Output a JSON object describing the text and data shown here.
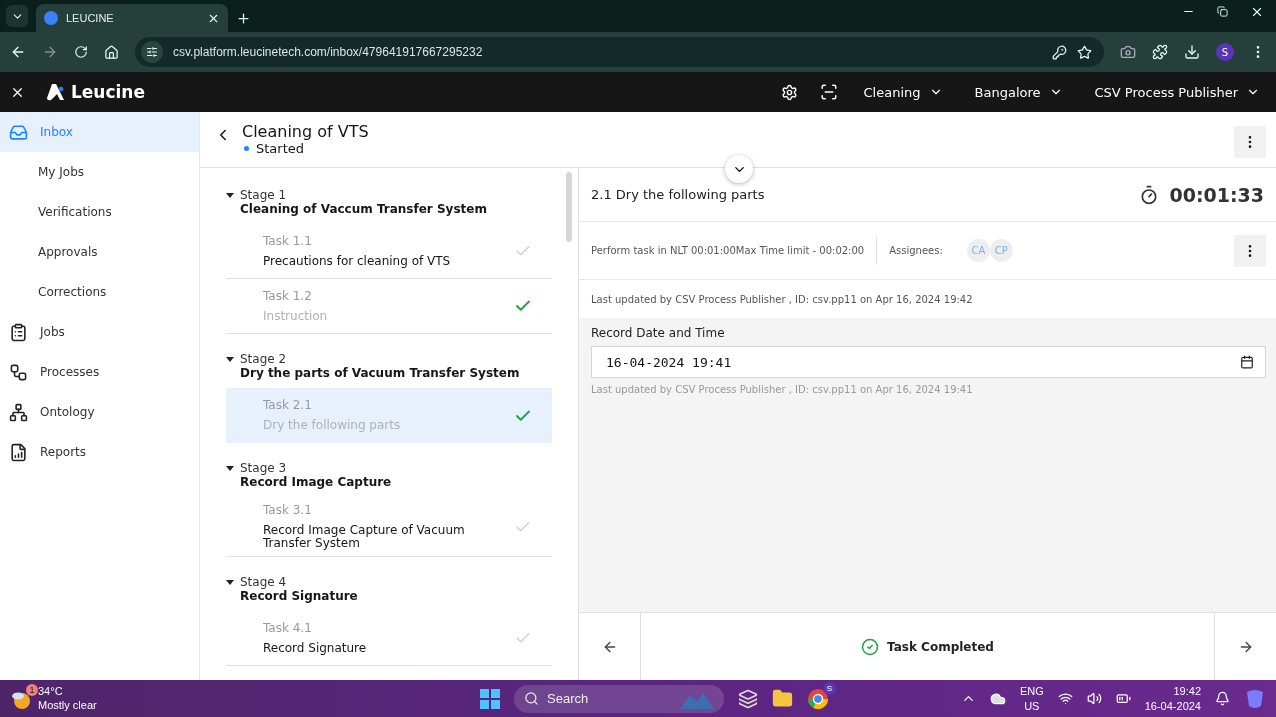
{
  "browser": {
    "tab_title": "LEUCINE",
    "url": "csv.platform.leucinetech.com/inbox/479641917667295232",
    "profile_initial": "S"
  },
  "app": {
    "brand": "Leucine",
    "dropdowns": [
      "Cleaning",
      "Bangalore",
      "CSV Process Publisher"
    ]
  },
  "sidebar": {
    "items": [
      {
        "label": "Inbox",
        "kind": "inbox",
        "selected": true
      },
      {
        "label": "My Jobs",
        "kind": "sub",
        "selected": false
      },
      {
        "label": "Verifications",
        "kind": "sub",
        "selected": false
      },
      {
        "label": "Approvals",
        "kind": "sub",
        "selected": false
      },
      {
        "label": "Corrections",
        "kind": "sub",
        "selected": false
      },
      {
        "label": "Jobs",
        "kind": "jobs",
        "selected": false
      },
      {
        "label": "Processes",
        "kind": "processes",
        "selected": false
      },
      {
        "label": "Ontology",
        "kind": "ontology",
        "selected": false
      },
      {
        "label": "Reports",
        "kind": "reports",
        "selected": false
      }
    ]
  },
  "job": {
    "title": "Cleaning of VTS",
    "status": "Started"
  },
  "stages": [
    {
      "label": "Stage 1",
      "name": "Cleaning of Vaccum Transfer System",
      "expanded": true,
      "tasks": [
        {
          "number": "Task 1.1",
          "name": "Precautions for cleaning of VTS",
          "completed": false,
          "selected": false
        },
        {
          "number": "Task 1.2",
          "name": "Instruction",
          "completed": true,
          "selected": false
        }
      ]
    },
    {
      "label": "Stage 2",
      "name": "Dry the parts of Vacuum Transfer System",
      "expanded": true,
      "tasks": [
        {
          "number": "Task 2.1",
          "name": "Dry the following parts",
          "completed": true,
          "selected": true
        }
      ]
    },
    {
      "label": "Stage 3",
      "name": "Record Image Capture",
      "expanded": true,
      "tasks": [
        {
          "number": "Task 3.1",
          "name": "Record Image Capture of Vacuum Transfer System",
          "completed": false,
          "selected": false
        }
      ]
    },
    {
      "label": "Stage 4",
      "name": "Record Signature",
      "expanded": true,
      "tasks": [
        {
          "number": "Task 4.1",
          "name": "Record Signature",
          "completed": false,
          "selected": false
        }
      ]
    }
  ],
  "task": {
    "title": "2.1 Dry the following parts",
    "timer": "00:01:33",
    "time_limit": "Perform task in NLT 00:01:00Max Time limit - 00:02:00",
    "assignees_label": "Assignees:",
    "assignees": [
      "CA",
      "CP"
    ],
    "last_updated": "Last updated by CSV Process Publisher , ID: csv.pp11 on Apr 16, 2024 19:42",
    "field": {
      "label": "Record Date and Time",
      "value": "16-04-2024 19:41",
      "note": "Last updated by CSV Process Publisher , ID: csv.pp11 on Apr 16, 2024 19:41"
    },
    "footer_status": "Task Completed"
  },
  "taskbar": {
    "weather": {
      "temperature": "34°C",
      "condition": "Mostly clear",
      "badge": "1"
    },
    "search_placeholder": "Search",
    "app_badge": "S",
    "language": [
      "ENG",
      "US"
    ],
    "time": "19:42",
    "date": "16-04-2024"
  }
}
